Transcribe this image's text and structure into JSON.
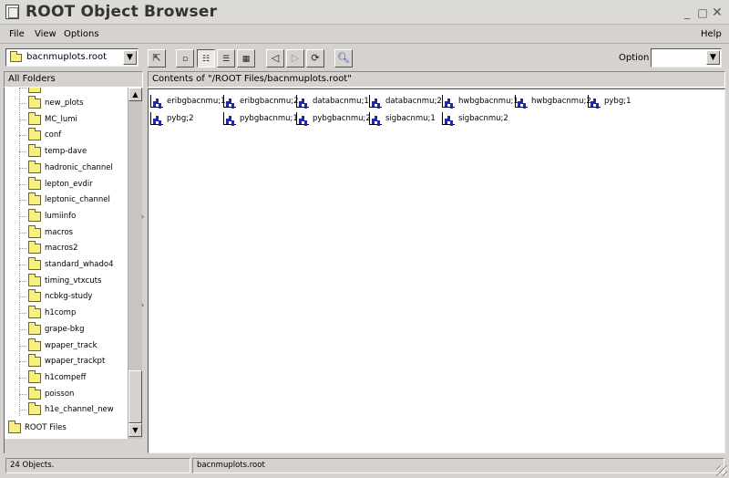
{
  "window": {
    "title": "ROOT Object Browser",
    "minimize": "_",
    "maximize": "□",
    "close": "✕"
  },
  "menu": {
    "file": "File",
    "view": "View",
    "options": "Options",
    "help": "Help"
  },
  "toolbar": {
    "location_value": "bacnmuplots.root",
    "option_label": "Option",
    "option_value": ""
  },
  "left_panel": {
    "header": "All Folders",
    "items": [
      "new_plots",
      "MC_lumi",
      "conf",
      "temp-dave",
      "hadronic_channel",
      "lepton_evdir",
      "leptonic_channel",
      "lumiinfo",
      "macros",
      "macros2",
      "standard_whado4",
      "timing_vtxcuts",
      "ncbkg-study",
      "h1comp",
      "grape-bkg",
      "wpaper_track",
      "wpaper_trackpt",
      "h1compeff",
      "poisson",
      "h1e_channel_new"
    ],
    "root_item": "ROOT Files"
  },
  "right_panel": {
    "header": "Contents of \"/ROOT Files/bacnmuplots.root\"",
    "objects": [
      "eribgbacnmu;1",
      "eribgbacnmu;2",
      "databacnmu;1",
      "databacnmu;2",
      "hwbgbacnmu;1",
      "hwbgbacnmu;2",
      "pybg;1",
      "pybg;2",
      "pybgbacnmu;1",
      "pybgbacnmu;2",
      "sigbacnmu;1",
      "sigbacnmu;2"
    ]
  },
  "status": {
    "count": "24 Objects.",
    "file": "bacnmuplots.root"
  },
  "icons": [
    "folder-icon",
    "histogram-icon",
    "up-folder-icon",
    "large-icons-icon",
    "small-icons-icon",
    "list-icon",
    "details-icon",
    "back-icon",
    "forward-icon",
    "refresh-icon",
    "find-icon"
  ]
}
